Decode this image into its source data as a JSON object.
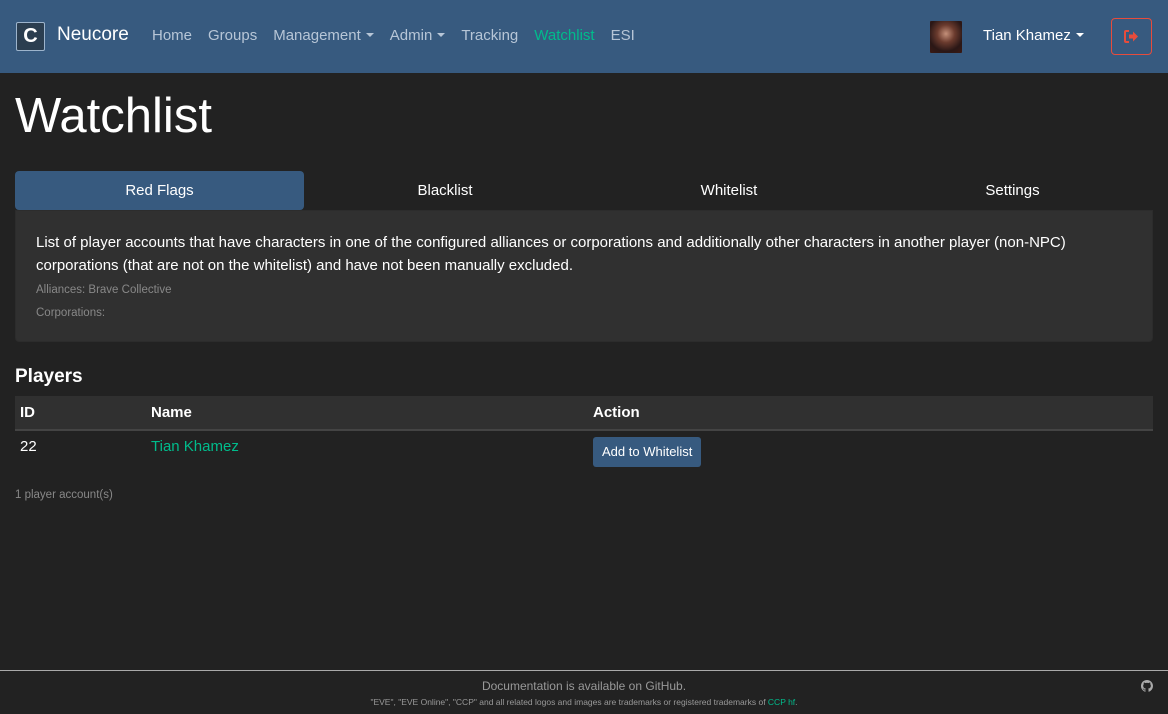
{
  "navbar": {
    "brand_letter": "C",
    "brand_name": "Neucore",
    "links": [
      {
        "label": "Home",
        "active": false,
        "dropdown": false
      },
      {
        "label": "Groups",
        "active": false,
        "dropdown": false
      },
      {
        "label": "Management",
        "active": false,
        "dropdown": true
      },
      {
        "label": "Admin",
        "active": false,
        "dropdown": true
      },
      {
        "label": "Tracking",
        "active": false,
        "dropdown": false
      },
      {
        "label": "Watchlist",
        "active": true,
        "dropdown": false
      },
      {
        "label": "ESI",
        "active": false,
        "dropdown": false
      }
    ],
    "user_name": "Tian Khamez",
    "logout_icon": "sign-out-icon"
  },
  "page": {
    "title": "Watchlist"
  },
  "tabs": [
    {
      "label": "Red Flags",
      "active": true
    },
    {
      "label": "Blacklist",
      "active": false
    },
    {
      "label": "Whitelist",
      "active": false
    },
    {
      "label": "Settings",
      "active": false
    }
  ],
  "info": {
    "description": "List of player accounts that have characters in one of the configured alliances or corporations and additionally other characters in another player (non-NPC) corporations (that are not on the whitelist) and have not been manually excluded.",
    "alliances": "Alliances: Brave Collective",
    "corporations": "Corporations:"
  },
  "players": {
    "heading": "Players",
    "columns": [
      "ID",
      "Name",
      "Action"
    ],
    "rows": [
      {
        "id": "22",
        "name": "Tian Khamez",
        "action_label": "Add to Whitelist"
      }
    ],
    "count_text": "1 player account(s)"
  },
  "footer": {
    "doc_text": "Documentation is available on GitHub.",
    "trademark_text": "\"EVE\", \"EVE Online\", \"CCP\" and all related logos and images are trademarks or registered trademarks of ",
    "trademark_link": "CCP hf",
    "trademark_end": "."
  },
  "colors": {
    "navbar": "#375a7f",
    "background": "#222222",
    "accent": "#00bc8c",
    "danger": "#e74c3c"
  }
}
